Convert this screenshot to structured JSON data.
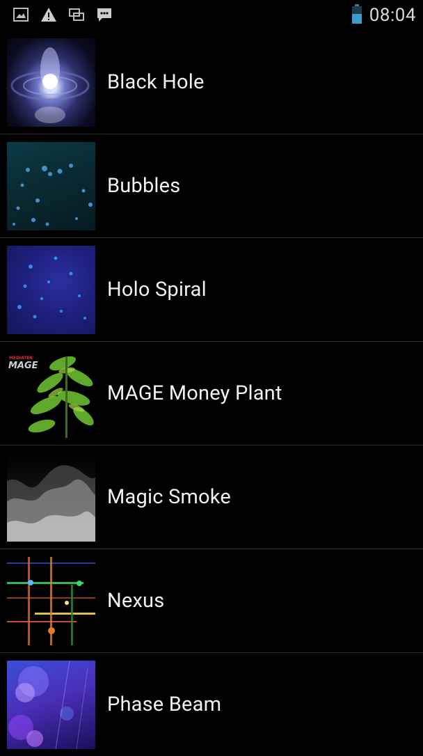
{
  "status_bar": {
    "time": "08:04",
    "icons": [
      "image-icon",
      "warning-icon",
      "sync-screens-icon",
      "chat-icon"
    ],
    "battery_icon": "battery-icon"
  },
  "wallpapers": [
    {
      "label": "Black Hole"
    },
    {
      "label": "Bubbles"
    },
    {
      "label": "Holo Spiral"
    },
    {
      "label": "MAGE Money Plant",
      "thumb_text_top": "MEDIATEK",
      "thumb_text": "MAGE"
    },
    {
      "label": "Magic Smoke"
    },
    {
      "label": "Nexus"
    },
    {
      "label": "Phase Beam"
    }
  ],
  "colors": {
    "background": "#000000",
    "divider": "#2e2e2e",
    "text": "#f2f2f2"
  }
}
